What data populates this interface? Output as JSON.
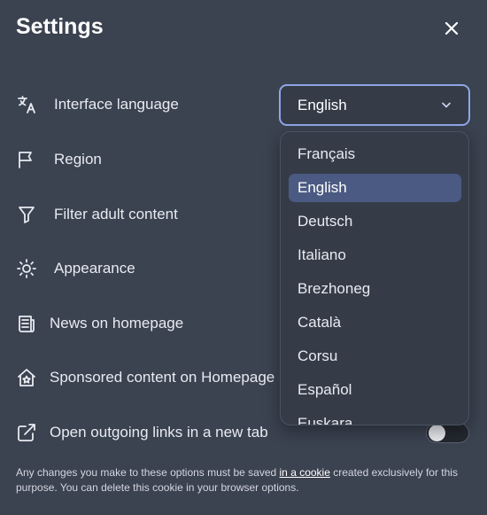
{
  "header": {
    "title": "Settings",
    "close_icon": "close-icon"
  },
  "settings": [
    {
      "label": "Interface language",
      "icon": "translate-icon"
    },
    {
      "label": "Region",
      "icon": "flag-icon"
    },
    {
      "label": "Filter adult content",
      "icon": "filter-icon"
    },
    {
      "label": "Appearance",
      "icon": "sun-icon"
    },
    {
      "label": "News on homepage",
      "icon": "newspaper-icon"
    },
    {
      "label": "Sponsored content on Homepage",
      "icon": "home-star-icon"
    },
    {
      "label": "Open outgoing links in a new tab",
      "icon": "external-link-icon"
    }
  ],
  "language_select": {
    "value": "English",
    "options": [
      "Français",
      "English",
      "Deutsch",
      "Italiano",
      "Brezhoneg",
      "Català",
      "Corsu",
      "Español",
      "Euskara"
    ],
    "selected_index": 1
  },
  "new_tab_toggle": {
    "on": false
  },
  "footer": {
    "text_before": "Any changes you make to these options must be saved ",
    "link": "in a cookie",
    "text_after": " created exclusively for this purpose. You can delete this cookie in your browser options."
  },
  "colors": {
    "background": "#3b4250",
    "accent_border": "#8fa6e6",
    "selected_option": "#4b5a82"
  }
}
